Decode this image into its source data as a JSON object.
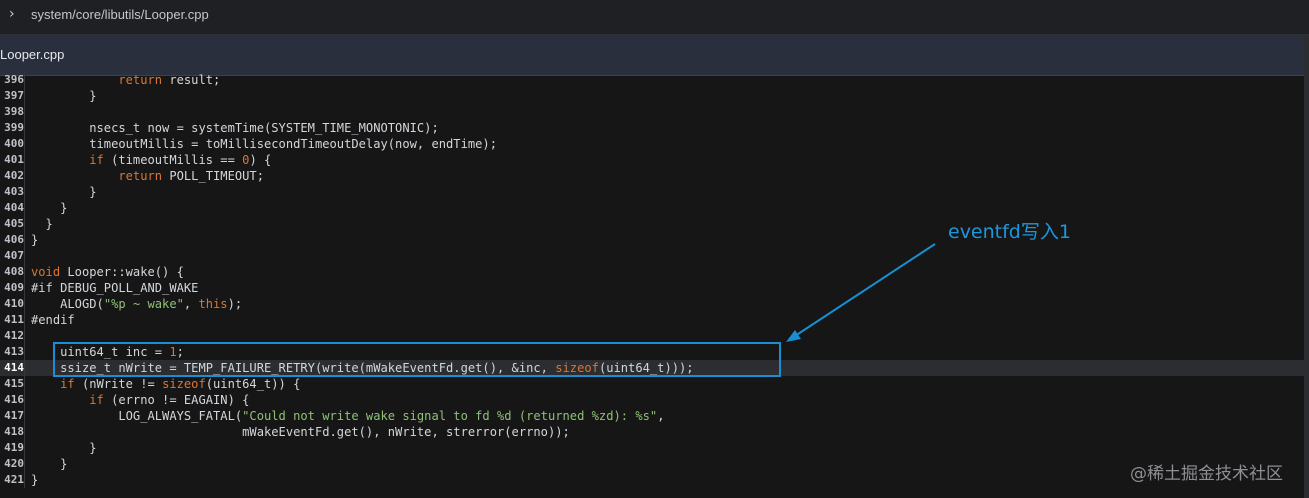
{
  "header": {
    "path": "system/core/libutils/Looper.cpp",
    "expand_icon": "chevron-right-icon"
  },
  "file": {
    "name": "Looper.cpp"
  },
  "code": {
    "highlighted_line": "414",
    "lines": [
      {
        "num": "396",
        "html": "            <span class=\"kw\">return</span> result;"
      },
      {
        "num": "397",
        "html": "        }"
      },
      {
        "num": "398",
        "html": ""
      },
      {
        "num": "399",
        "html": "        nsecs_t now = systemTime(SYSTEM_TIME_MONOTONIC);"
      },
      {
        "num": "400",
        "html": "        timeoutMillis = toMillisecondTimeoutDelay(now, endTime);"
      },
      {
        "num": "401",
        "html": "        <span class=\"kw\">if</span> (timeoutMillis == <span class=\"num\">0</span>) {"
      },
      {
        "num": "402",
        "html": "            <span class=\"kw\">return</span> POLL_TIMEOUT;"
      },
      {
        "num": "403",
        "html": "        }"
      },
      {
        "num": "404",
        "html": "    }"
      },
      {
        "num": "405",
        "html": "  }"
      },
      {
        "num": "406",
        "html": "}"
      },
      {
        "num": "407",
        "html": ""
      },
      {
        "num": "408",
        "html": "<span class=\"kw\">void</span> Looper::wake() {"
      },
      {
        "num": "409",
        "html": "#if DEBUG_POLL_AND_WAKE"
      },
      {
        "num": "410",
        "html": "    ALOGD(<span class=\"str\">\"%p ~ wake\"</span>, <span class=\"kw\">this</span>);"
      },
      {
        "num": "411",
        "html": "#endif"
      },
      {
        "num": "412",
        "html": ""
      },
      {
        "num": "413",
        "html": "    uint64_t inc = <span class=\"num\">1</span>;"
      },
      {
        "num": "414",
        "html": "    ssize_t nWrite = TEMP_FAILURE_RETRY(write(mWakeEventFd.get(), &amp;inc, <span class=\"kw\">sizeof</span>(uint64_t)));"
      },
      {
        "num": "415",
        "html": "    <span class=\"kw\">if</span> (nWrite != <span class=\"kw\">sizeof</span>(uint64_t)) {"
      },
      {
        "num": "416",
        "html": "        <span class=\"kw\">if</span> (errno != EAGAIN) {"
      },
      {
        "num": "417",
        "html": "            LOG_ALWAYS_FATAL(<span class=\"str\">\"Could not write wake signal to fd %d (returned %zd): %s\"</span>,"
      },
      {
        "num": "418",
        "html": "                             mWakeEventFd.get(), nWrite, strerror(errno));"
      },
      {
        "num": "419",
        "html": "        }"
      },
      {
        "num": "420",
        "html": "    }"
      },
      {
        "num": "421",
        "html": "}"
      }
    ]
  },
  "annotation": {
    "text": "eventfd写入1",
    "color": "#1d97dc"
  },
  "watermark": {
    "text": "@稀土掘金技术社区"
  },
  "colors": {
    "keyword": "#dd7630",
    "string": "#8fc175",
    "text": "#d3d6db",
    "background": "#161617"
  }
}
